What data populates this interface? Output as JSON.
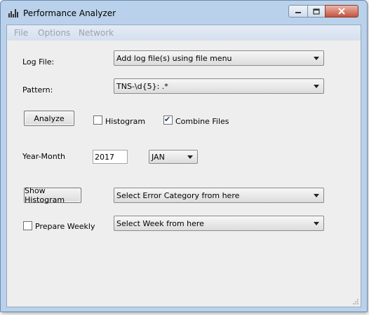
{
  "window": {
    "title": "Performance Analyzer"
  },
  "menu": {
    "items": [
      "File",
      "Options",
      "Network"
    ]
  },
  "log_file": {
    "label": "Log File:",
    "value": "Add log file(s) using file menu"
  },
  "pattern": {
    "label": "Pattern:",
    "value": "TNS-\\d{5}: .*"
  },
  "analyze": {
    "button_label": "Analyze"
  },
  "histogram": {
    "label": "Histogram",
    "checked": false
  },
  "combine_files": {
    "label": "Combine Files",
    "checked": true
  },
  "year_month": {
    "label": "Year-Month",
    "year": "2017",
    "month": "JAN"
  },
  "show_histogram": {
    "button_label": "Show Histogram"
  },
  "error_category": {
    "value": "Select Error Category from here"
  },
  "prepare_weekly": {
    "label": "Prepare Weekly",
    "checked": false
  },
  "week": {
    "value": "Select Week from here"
  },
  "colors": {
    "title_bar": "#b9d1ea",
    "client_bg": "#eeeeee",
    "close_button": "#c7533f"
  }
}
